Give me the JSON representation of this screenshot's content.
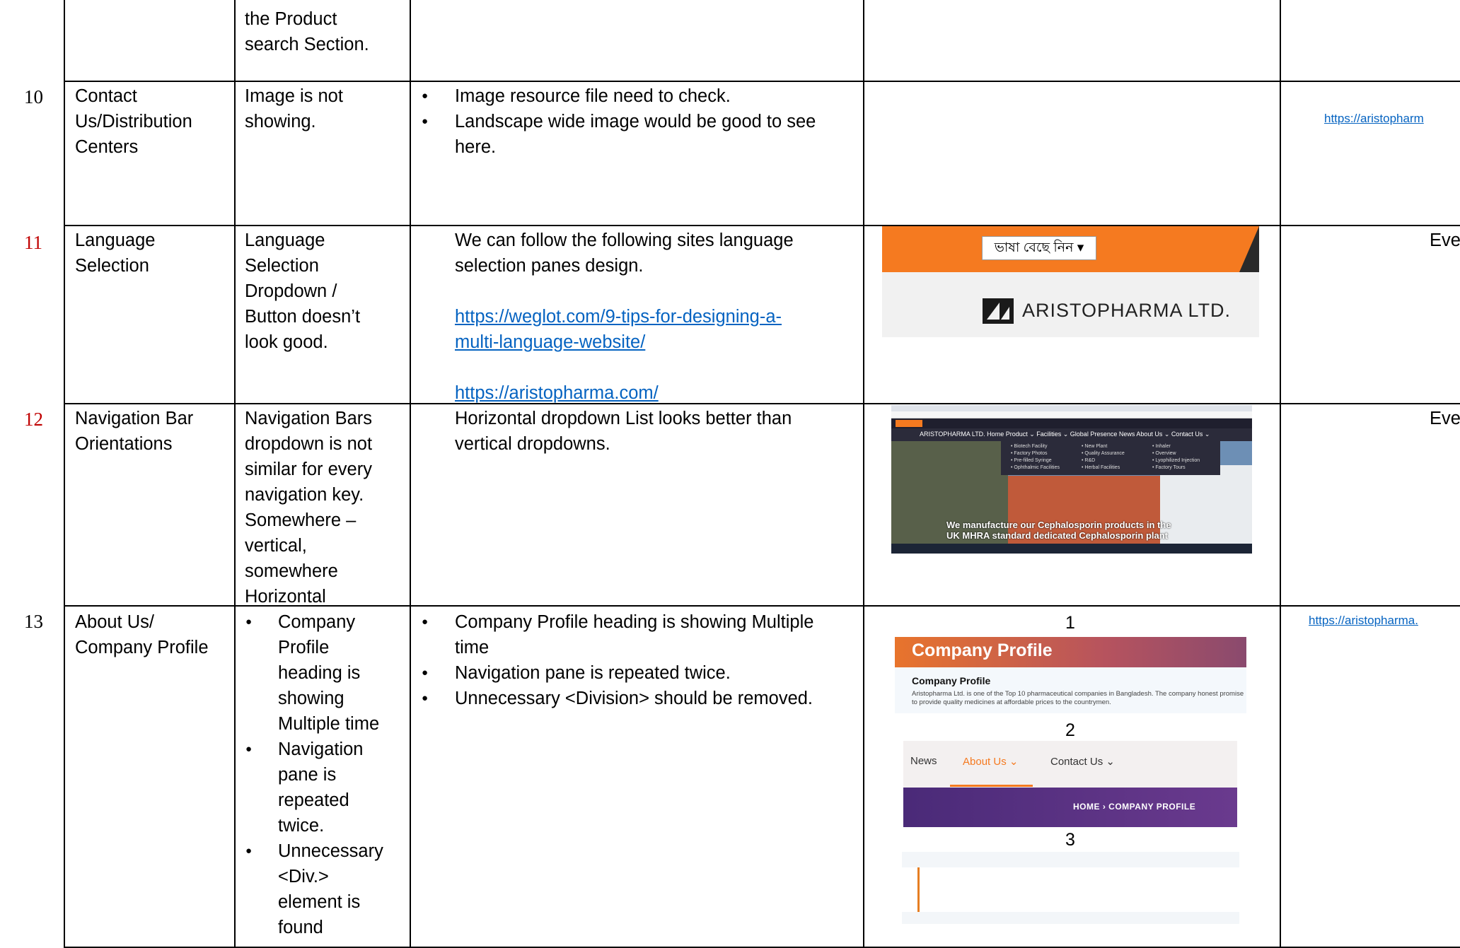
{
  "rows": [
    {
      "number": "",
      "description_lines": [
        "the Product",
        "search Section."
      ]
    },
    {
      "number": "10",
      "section_lines": [
        "Contact",
        "Us/Distribution",
        "Centers"
      ],
      "issue_lines": [
        "Image is not",
        "showing."
      ],
      "suggestions": [
        {
          "lines": [
            "Image resource file need to check."
          ]
        },
        {
          "lines": [
            "Landscape wide image would be good to see",
            "here."
          ]
        }
      ],
      "link": "https://aristopharm"
    },
    {
      "number": "11",
      "section_lines": [
        "Language",
        "Selection"
      ],
      "issue_lines": [
        "Language",
        "Selection",
        "Dropdown /",
        "Button doesn’t",
        "look good."
      ],
      "suggestion_lines": [
        "We can follow the following sites language",
        "selection panes design."
      ],
      "links": {
        "weglot_lines": [
          "https://weglot.com/9-tips-for-designing-a-",
          "multi-language-website/"
        ],
        "aristo": "https://aristopharma.com/"
      },
      "image": {
        "dropdown_label": "ভাষা বেছে নিন ▾",
        "brand": "ARISTOPHARMA LTD."
      },
      "scope": "Eve"
    },
    {
      "number": "12",
      "section_lines": [
        "Navigation Bar",
        "Orientations"
      ],
      "issue_lines": [
        "Navigation Bars",
        "dropdown is not",
        "similar for every",
        "navigation key.",
        "Somewhere –",
        "vertical,",
        "somewhere",
        "Horizontal"
      ],
      "suggestion_lines": [
        "Horizontal dropdown List looks better than",
        "vertical dropdowns."
      ],
      "image": {
        "menu": "ARISTOPHARMA LTD.      Home   Product ⌄   Facilities ⌄   Global Presence   News   About Us ⌄   Contact Us ⌄",
        "dropdown_items": [
          "• Biotech Facility",
          "• Factory Photos",
          "• Pre-filled Syringe",
          "• Ophthalmic Facilities",
          "• New Plant",
          "• Quality Assurance",
          "• R&D",
          "• Herbal Facilities",
          "• Inhaler",
          "• Overview",
          "• Lyophilized Injection",
          "• Factory Tours"
        ],
        "hero_lines": [
          "We manufacture our Cephalosporin products in the",
          "UK MHRA standard dedicated Cephalosporin plant"
        ]
      },
      "scope": "Eve"
    },
    {
      "number": "13",
      "section_lines": [
        "About Us/",
        "Company Profile"
      ],
      "issues": [
        {
          "lines": [
            "Company",
            "Profile",
            "heading is",
            "showing",
            "Multiple time"
          ]
        },
        {
          "lines": [
            "Navigation",
            "pane is",
            "repeated",
            "twice."
          ]
        },
        {
          "lines": [
            "Unnecessary",
            "<Div.>",
            "element is",
            "found"
          ]
        }
      ],
      "suggestions": [
        {
          "lines": [
            "Company Profile heading is showing Multiple",
            "time"
          ]
        },
        {
          "lines": [
            "Navigation pane is repeated twice."
          ]
        },
        {
          "lines": [
            "Unnecessary <Division> should be removed."
          ]
        }
      ],
      "screenshots": {
        "label_1": "1",
        "label_2": "2",
        "label_3": "3",
        "cp_heading": "Company Profile",
        "cp_subheading": "Company Profile",
        "cp_paragraph": "Aristopharma Ltd. is one of the Top 10 pharmaceutical companies in Bangladesh. The company honest promise to provide quality medicines at affordable prices to the countrymen.",
        "nav_news": "News",
        "nav_about": "About Us ⌄",
        "nav_contact": "Contact Us ⌄",
        "breadcrumb": "HOME  ›  COMPANY PROFILE"
      },
      "link": "https://aristopharma."
    }
  ],
  "colors": {
    "link": "#0563c1",
    "row_number_red": "#c00000",
    "accent_orange": "#f57a20"
  }
}
